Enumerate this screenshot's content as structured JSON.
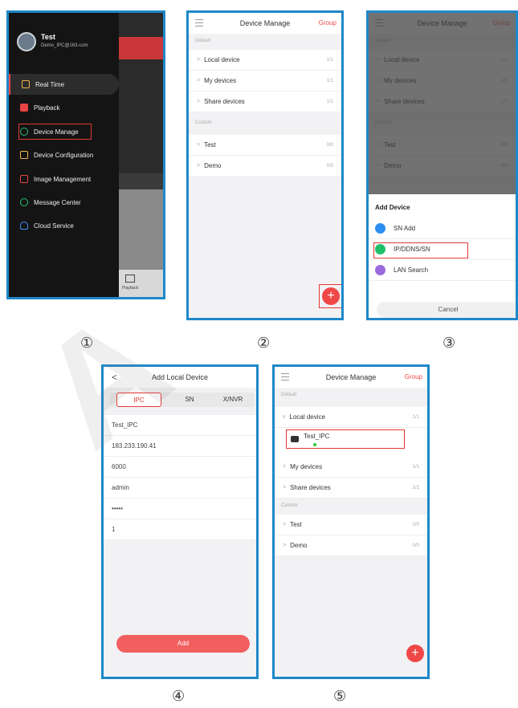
{
  "screen1": {
    "user_name": "Test",
    "user_email": "Demo_IPC@163.com",
    "menu": [
      {
        "label": "Real Time",
        "icon": "realtime-icon"
      },
      {
        "label": "Playback",
        "icon": "playback-icon"
      },
      {
        "label": "Device Manage",
        "icon": "device-manage-icon"
      },
      {
        "label": "Device Configuration",
        "icon": "device-config-icon"
      },
      {
        "label": "Image Management",
        "icon": "image-icon"
      },
      {
        "label": "Message Center",
        "icon": "message-icon"
      },
      {
        "label": "Cloud Service",
        "icon": "cloud-icon"
      }
    ],
    "tab_label": "Playback"
  },
  "device_manage": {
    "title": "Device Manage",
    "group": "Group",
    "section_default": "Default",
    "section_custom": "Custom",
    "rows": [
      {
        "label": "Local device",
        "count": "1/1"
      },
      {
        "label": "My devices",
        "count": "1/1"
      },
      {
        "label": "Share devices",
        "count": "1/1"
      },
      {
        "label": "Test",
        "count": "0/0"
      },
      {
        "label": "Demo",
        "count": "0/0"
      }
    ],
    "fab": "+"
  },
  "add_device": {
    "title": "Add Device",
    "options": [
      {
        "label": "SN Add",
        "color": "#2d8ef0"
      },
      {
        "label": "IP/DDNS/SN",
        "color": "#1fbf6a"
      },
      {
        "label": "LAN Search",
        "color": "#9b6bdc"
      }
    ],
    "cancel": "Cancel"
  },
  "add_local": {
    "back": "<",
    "title": "Add Local Device",
    "tabs": [
      "IPC",
      "SN",
      "X/NVR"
    ],
    "fields": [
      "Test_IPC",
      "183.233.190.41",
      "6000",
      "admin",
      "•••••",
      "1"
    ],
    "add_button": "Add"
  },
  "device_manage_after": {
    "device_name": "Test_IPC"
  },
  "step_labels": [
    "①",
    "②",
    "③",
    "④",
    "⑤"
  ],
  "watermark": "A"
}
